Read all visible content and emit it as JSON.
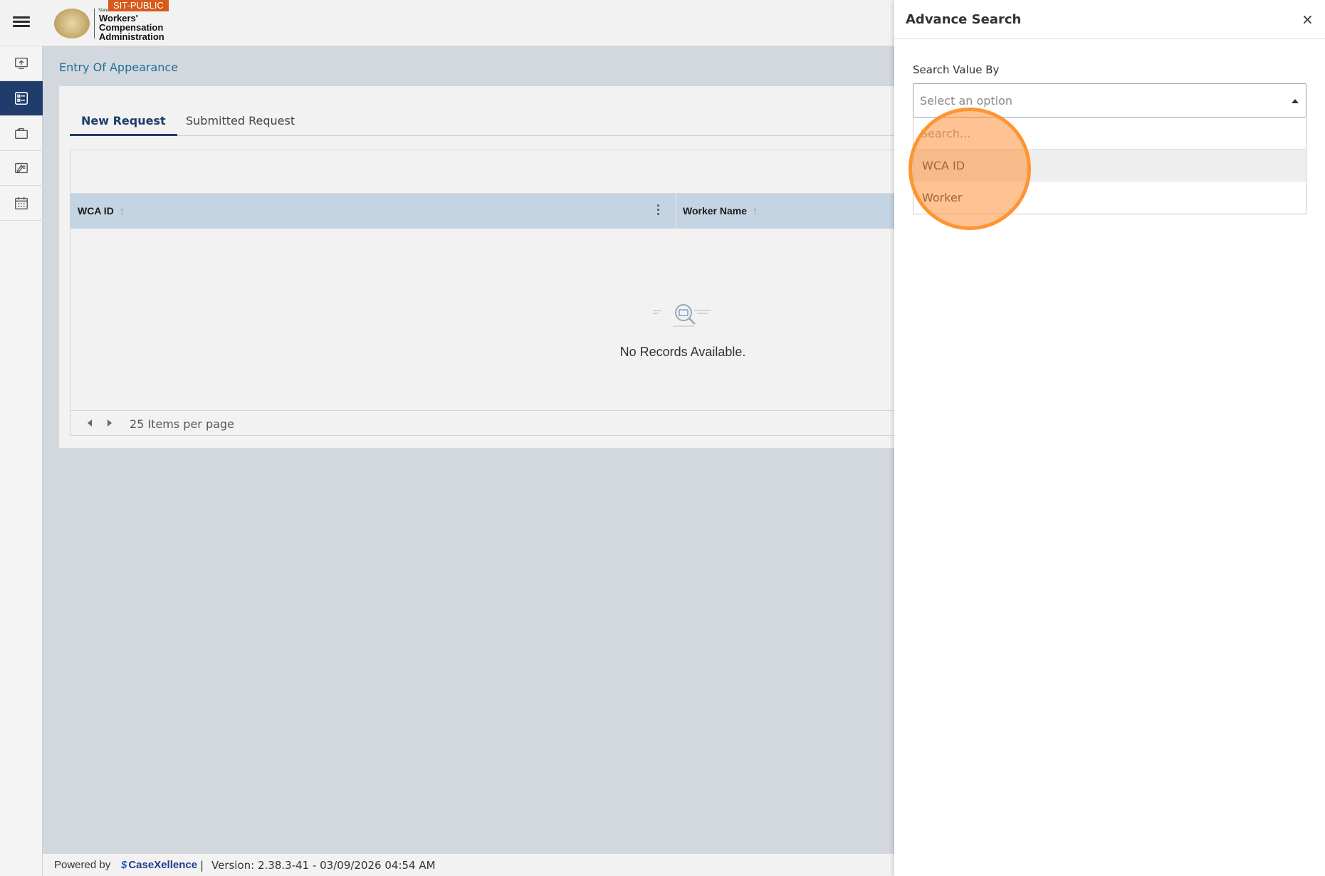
{
  "header": {
    "env_badge": "SIT-PUBLIC",
    "logo_state": "State",
    "logo_line1": "Workers'",
    "logo_line2": "Compensation",
    "logo_line3": "Administration"
  },
  "leftnav": {
    "items": [
      {
        "icon": "upload-monitor-icon",
        "active": false
      },
      {
        "icon": "list-icon",
        "active": true
      },
      {
        "icon": "briefcase-icon",
        "active": false
      },
      {
        "icon": "edit-document-icon",
        "active": false
      },
      {
        "icon": "calendar-icon",
        "active": false
      }
    ]
  },
  "breadcrumb": "Entry Of Appearance",
  "tabs": [
    {
      "label": "New Request",
      "active": true
    },
    {
      "label": "Submitted Request",
      "active": false
    }
  ],
  "grid": {
    "columns": [
      {
        "label": "WCA ID",
        "sort": "↑"
      },
      {
        "label": "Worker Name",
        "sort": "↑"
      }
    ],
    "empty_message": "No Records Available.",
    "page_size_label": "25 Items per page"
  },
  "footer": {
    "powered_by": "Powered by",
    "brand": "CaseXellence",
    "pipe": "|",
    "version": "Version: 2.38.3-41 - 03/09/2026 04:54 AM"
  },
  "panel": {
    "title": "Advance Search",
    "close": "×",
    "field_label": "Search Value By",
    "select_placeholder": "Select an option",
    "search_placeholder": "Search...",
    "options": [
      "WCA ID",
      "Worker"
    ]
  },
  "colors": {
    "nav_active": "#1f3c6b",
    "breadcrumb": "#1f6e9c",
    "grid_header": "#c5d4e2",
    "env_badge": "#d85a1a",
    "click_marker": "#ff9432"
  }
}
